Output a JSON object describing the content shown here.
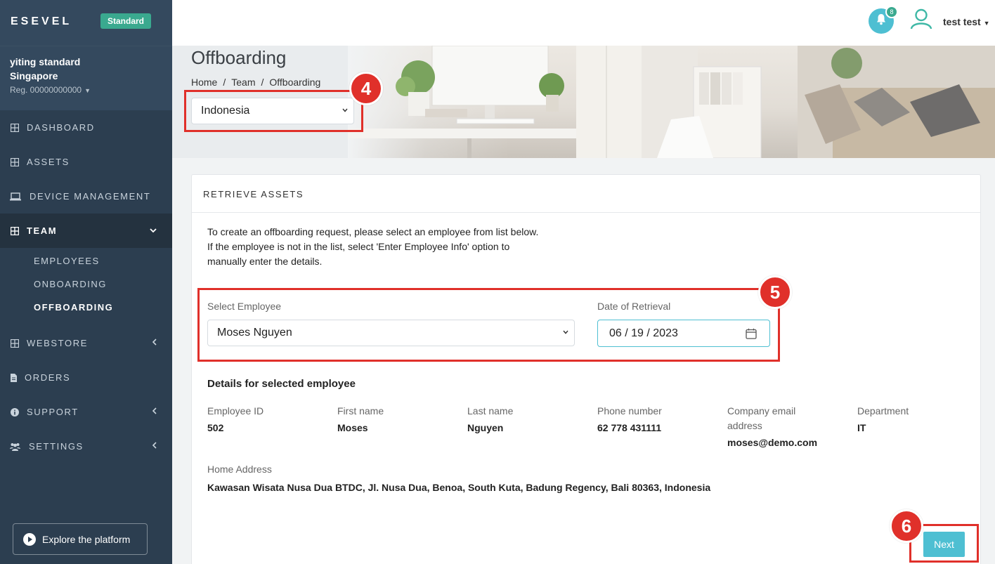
{
  "sidebar": {
    "brand": "ESEVEL",
    "plan": "Standard",
    "org_line1": "yiting standard",
    "org_line2": "Singapore",
    "reg": "Reg. 00000000000",
    "items": [
      {
        "label": "DASHBOARD",
        "icon": "grid-icon"
      },
      {
        "label": "ASSETS",
        "icon": "grid-icon"
      },
      {
        "label": "DEVICE MANAGEMENT",
        "icon": "laptop-icon"
      },
      {
        "label": "TEAM",
        "icon": "grid-icon"
      },
      {
        "label": "WEBSTORE",
        "icon": "grid-icon"
      },
      {
        "label": "ORDERS",
        "icon": "file-icon"
      },
      {
        "label": "SUPPORT",
        "icon": "info-icon"
      },
      {
        "label": "SETTINGS",
        "icon": "users-icon"
      }
    ],
    "team_sub": [
      "EMPLOYEES",
      "ONBOARDING",
      "OFFBOARDING"
    ],
    "explore": "Explore the platform"
  },
  "topbar": {
    "notification_count": "8",
    "user_name": "test test"
  },
  "header": {
    "title": "Offboarding",
    "breadcrumb": [
      "Home",
      "Team",
      "Offboarding"
    ],
    "country": "Indonesia"
  },
  "card": {
    "title": "RETRIEVE ASSETS",
    "intro": [
      "To create an offboarding request, please select an employee from list below.",
      "If the employee is not in the list, select 'Enter Employee Info' option to",
      "manually enter the details."
    ],
    "employee_label": "Select Employee",
    "employee_value": "Moses Nguyen",
    "date_label": "Date of Retrieval",
    "date_value": "06 / 19 / 2023",
    "details_title": "Details for selected employee",
    "fields": [
      {
        "label": "Employee ID",
        "value": "502"
      },
      {
        "label": "First name",
        "value": "Moses"
      },
      {
        "label": "Last name",
        "value": "Nguyen"
      },
      {
        "label": "Phone number",
        "value": "62 778 431111"
      },
      {
        "label": "Company email address",
        "value": "moses@demo.com"
      },
      {
        "label": "Department",
        "value": "IT"
      }
    ],
    "address_label": "Home Address",
    "address_value": "Kawasan Wisata Nusa Dua BTDC, Jl. Nusa Dua, Benoa, South Kuta, Badung Regency, Bali 80363, Indonesia",
    "next_label": "Next"
  },
  "annotations": [
    "4",
    "5",
    "6"
  ],
  "colors": {
    "sidebar_bg": "#2c3e50",
    "accent": "#4ebfd2",
    "badge_green": "#3aa98f",
    "annotation_red": "#e0302a"
  }
}
